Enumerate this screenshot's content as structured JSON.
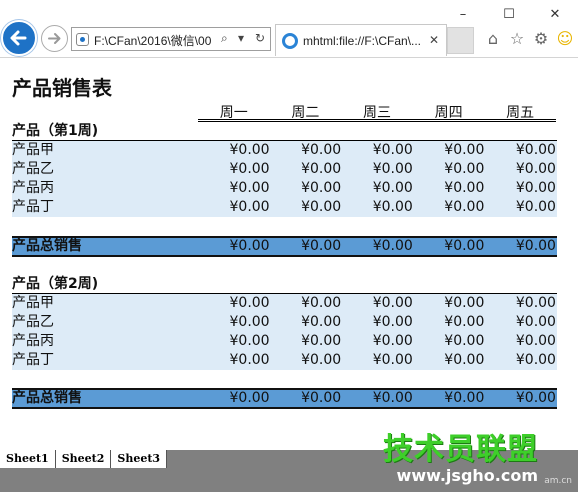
{
  "browser": {
    "address": "F:\\CFan\\2016\\微信\\00",
    "tab_title": "mhtml:file://F:\\CFan\\...",
    "window_controls": [
      "–",
      "☐",
      "✕"
    ]
  },
  "sheet": {
    "title": "产品销售表",
    "days": [
      "周一",
      "周二",
      "周三",
      "周四",
      "周五"
    ],
    "groups": [
      {
        "title": "产品（第1周)",
        "rows": [
          {
            "label": "产品甲",
            "values": [
              "¥0.00",
              "¥0.00",
              "¥0.00",
              "¥0.00",
              "¥0.00"
            ]
          },
          {
            "label": "产品乙",
            "values": [
              "¥0.00",
              "¥0.00",
              "¥0.00",
              "¥0.00",
              "¥0.00"
            ]
          },
          {
            "label": "产品丙",
            "values": [
              "¥0.00",
              "¥0.00",
              "¥0.00",
              "¥0.00",
              "¥0.00"
            ]
          },
          {
            "label": "产品丁",
            "values": [
              "¥0.00",
              "¥0.00",
              "¥0.00",
              "¥0.00",
              "¥0.00"
            ]
          }
        ],
        "total": {
          "label": "产品总销售",
          "values": [
            "¥0.00",
            "¥0.00",
            "¥0.00",
            "¥0.00",
            "¥0.00"
          ]
        }
      },
      {
        "title": "产品（第2周)",
        "rows": [
          {
            "label": "产品甲",
            "values": [
              "¥0.00",
              "¥0.00",
              "¥0.00",
              "¥0.00",
              "¥0.00"
            ]
          },
          {
            "label": "产品乙",
            "values": [
              "¥0.00",
              "¥0.00",
              "¥0.00",
              "¥0.00",
              "¥0.00"
            ]
          },
          {
            "label": "产品丙",
            "values": [
              "¥0.00",
              "¥0.00",
              "¥0.00",
              "¥0.00",
              "¥0.00"
            ]
          },
          {
            "label": "产品丁",
            "values": [
              "¥0.00",
              "¥0.00",
              "¥0.00",
              "¥0.00",
              "¥0.00"
            ]
          }
        ],
        "total": {
          "label": "产品总销售",
          "values": [
            "¥0.00",
            "¥0.00",
            "¥0.00",
            "¥0.00",
            "¥0.00"
          ]
        }
      }
    ],
    "tabs": [
      "Sheet1",
      "Sheet2",
      "Sheet3"
    ]
  },
  "watermark": {
    "brand": "技术员联盟",
    "url": "www.jsgho.com",
    "small": "am.cn"
  },
  "colors": {
    "row_fill": "#ddebf7",
    "total_fill": "#5b9bd5",
    "back_button": "#1e72c6"
  }
}
